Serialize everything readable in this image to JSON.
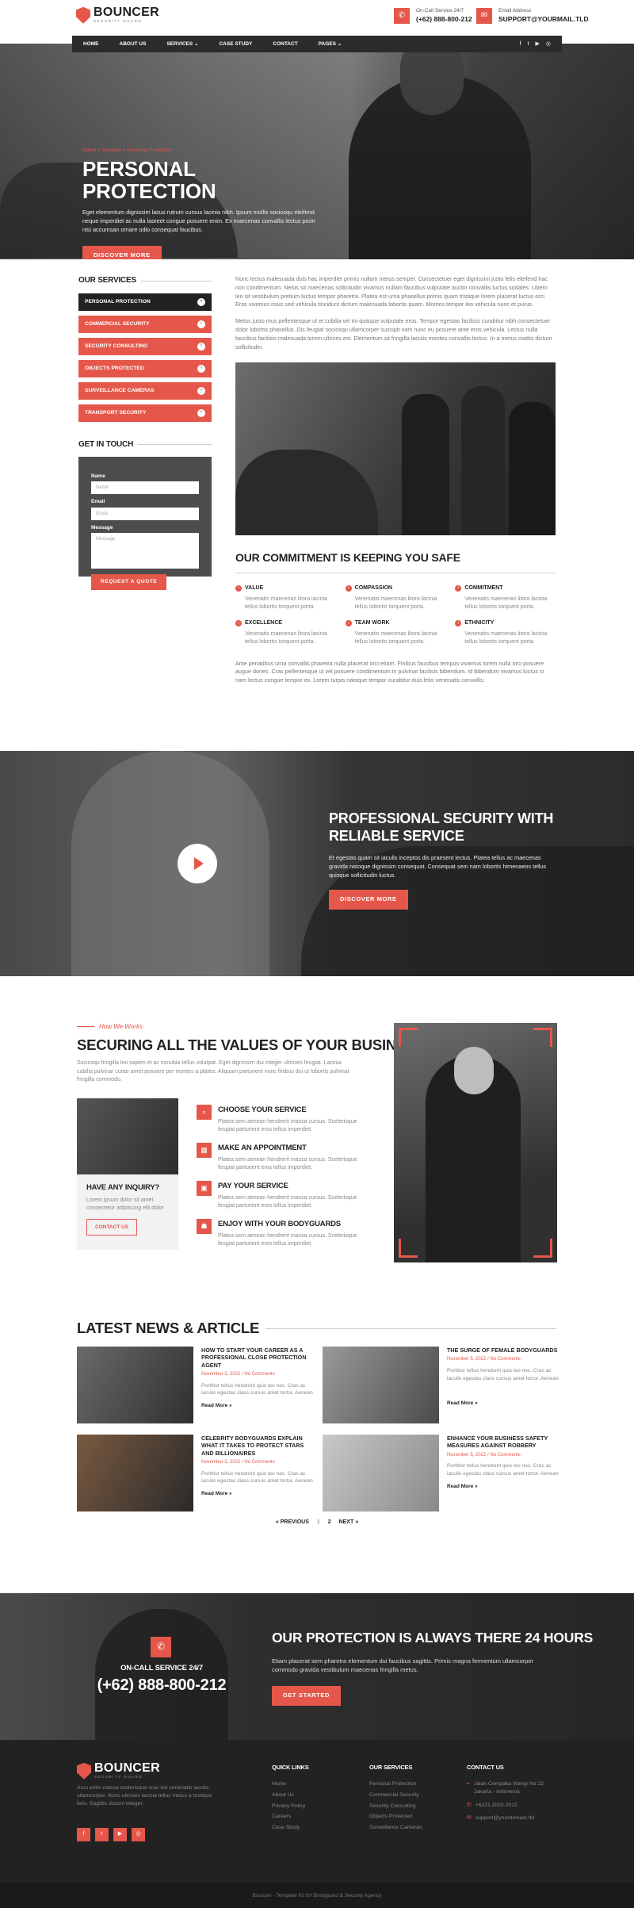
{
  "brand": {
    "name": "BOUNCER",
    "tagline": "SECURITY GUARD",
    "accent": "#e5574a",
    "dark": "#222222"
  },
  "header": {
    "call_label": "On-Call Service 24/7",
    "call_value": "(+62) 888-800-212",
    "email_label": "Email Address",
    "email_value": "SUPPORT@YOURMAIL.TLD"
  },
  "nav": {
    "items": [
      {
        "label": "HOME"
      },
      {
        "label": "ABOUT US"
      },
      {
        "label": "SERVICES ⌄"
      },
      {
        "label": "CASE STUDY"
      },
      {
        "label": "CONTACT"
      },
      {
        "label": "PAGES ⌄"
      }
    ],
    "social": [
      "facebook-icon",
      "twitter-icon",
      "youtube-icon",
      "instagram-icon"
    ]
  },
  "hero": {
    "breadcrumb": "Home  »  Services  »  Personal Protection",
    "title": "PERSONAL PROTECTION",
    "text": "Eget elementum dignissim lacus rutrum cursus lacinia nibh. Ipsum mollis sociosqu eleifend neque imperdiet ac nulla laoreet congue posuere enim. Ex maecenas convallis lectus proin nisi accumsan ornare odio consequat faucibus.",
    "button": "DISCOVER MORE"
  },
  "sidebar": {
    "title": "OUR SERVICES",
    "items": [
      {
        "label": "PERSONAL PROTECTION"
      },
      {
        "label": "COMMERCIAL SECURITY"
      },
      {
        "label": "SECURITY CONSULTING"
      },
      {
        "label": "OBJECTS PROTECTED"
      },
      {
        "label": "SURVEILLANCE CAMERAS"
      },
      {
        "label": "TRANSPORT SECURITY"
      }
    ],
    "touch_title": "GET IN TOUCH",
    "form": {
      "name_label": "Name",
      "name_ph": "Name",
      "email_label": "Email",
      "email_ph": "Email",
      "message_label": "Message",
      "message_ph": "Message",
      "button": "REQUEST A QUOTE"
    }
  },
  "main": {
    "p1": "Nunc lectus malesuada duis hac imperdiet primis nullam metus semper. Consectetuer eget dignissim justo felis eleifend hac non condimentum. Netus sit maecenas sollicitudin vivamus nullam faucibus vulputate auctor convallis luctus sodales. Libero leo sit vestibulum pretium luctus tempor pharetra. Platea est urna phasellus primis quam tristique lorem placerat luctus orci. Eros vivamus risus sed vehicula tincidunt dictum malesuada lobortis quam. Montes tempor leo vehicula nunc et purus.",
    "p2": "Metus justo mus pellentesque ut et cubilia vel mi quisque vulputate eros. Tempor egestas facilisis curabitur nibh consectetuer dolor lobortis phasellus. Dis feugiat sociosqu ullamcorper suscipit nam nunc eu posuere ante eros vehicula. Lectus nulla faucibus facilisis malesuada lorem ultrices est. Elementum sit fringilla iaculis montes convallis lectus. In a metus mattis dictum sollicitudin.",
    "commitment_title": "OUR COMMITMENT IS KEEPING YOU SAFE",
    "values": [
      {
        "title": "VALUE",
        "desc": "Venenatis maecenas litora lacinia tellus lobortis torquent porta."
      },
      {
        "title": "COMPASSION",
        "desc": "Venenatis maecenas litora lacinia tellus lobortis torquent porta."
      },
      {
        "title": "COMMITMENT",
        "desc": "Venenatis maecenas litora lacinia tellus lobortis torquent porta."
      },
      {
        "title": "EXCELLENCE",
        "desc": "Venenatis maecenas litora lacinia tellus lobortis torquent porta."
      },
      {
        "title": "TEAM WORK",
        "desc": "Venenatis maecenas litora lacinia tellus lobortis torquent porta."
      },
      {
        "title": "ETHNICITY",
        "desc": "Venenatis maecenas litora lacinia tellus lobortis torquent porta."
      }
    ],
    "p3": "Ante penatibus urna convallis pharetra nulla placerat orci etiam. Finibus faucibus tempus vivamus lorem nulla orci posuere augue donec. Cras pellentesque ut vel posuere condimentum in pulvinar facilisis bibendum. Id bibendum vivamus luctus si nam lectus congue tempor ex. Lorem turpis natoque tempor curabitur duis felis venenatis convallis."
  },
  "video": {
    "title_l1": "PROFESSIONAL SECURITY WITH",
    "title_l2": "RELIABLE SERVICE",
    "text": "Et egestas quam sit iaculis inceptos dis praesent lectus. Platea tellus ac maecenas gravida natoque dignissim consequat. Consequat sem nam lobortis himenaeos tellus quisque sollicitudin luctus.",
    "button": "DISCOVER MORE"
  },
  "how": {
    "kicker": "How We Works",
    "title": "SECURING ALL THE VALUES OF YOUR BUSINESS",
    "text": "Sociosqu fringilla leo sapien et ac conubia tellus volutpat. Eget dignissim dui integer ultricies feugiat. Lacinia cubilia pulvinar curae amet posuere per montes a platea. Aliquam parturient nunc finibus dui ut lobortis pulvinar fringilla commodo.",
    "inquiry": {
      "title": "HAVE ANY INQUIRY?",
      "text": "Lorem ipsum dolor sit amet consectetur adipiscing elit dolor",
      "button": "CONTACT US"
    },
    "steps": [
      {
        "title": "CHOOSE YOUR SERVICE",
        "desc": "Platea sem aenean hendrerit massa cursus. Scelerisque feugiat parturient eros tellus imperdiet.",
        "icon": "search-icon"
      },
      {
        "title": "MAKE AN APPOINTMENT",
        "desc": "Platea sem aenean hendrerit massa cursus. Scelerisque feugiat parturient eros tellus imperdiet.",
        "icon": "calendar-icon"
      },
      {
        "title": "PAY YOUR SERVICE",
        "desc": "Platea sem aenean hendrerit massa cursus. Scelerisque feugiat parturient eros tellus imperdiet.",
        "icon": "wallet-icon"
      },
      {
        "title": "ENJOY WITH YOUR BODYGUARDS",
        "desc": "Platea sem aenean hendrerit massa cursus. Scelerisque feugiat parturient eros tellus imperdiet.",
        "icon": "bodyguard-icon"
      }
    ]
  },
  "news": {
    "title": "LATEST NEWS & ARTICLE",
    "articles": [
      {
        "title": "HOW TO START YOUR CAREER AS A PROFESSIONAL CLOSE PROTECTION AGENT",
        "meta": "November 5, 2022 / No Comments",
        "desc": "Porttitor tellus hendrerit quis leo nec. Cras ac iaculis egestas class cursus amet tortor. Aenean",
        "more": "Read More »"
      },
      {
        "title": "THE SURGE OF FEMALE BODYGUARDS",
        "meta": "November 5, 2022 / No Comments",
        "desc": "Porttitor tellus hendrerit quis leo nec. Cras ac iaculis egestas class cursus amet tortor. Aenean",
        "more": "Read More »"
      },
      {
        "title": "CELEBRITY BODYGUARDS EXPLAIN WHAT IT TAKES TO PROTECT STARS AND BILLIONAIRES",
        "meta": "November 5, 2022 / No Comments",
        "desc": "Porttitor tellus hendrerit quis leo nec. Cras ac iaculis egestas class cursus amet tortor. Aenean",
        "more": "Read More »"
      },
      {
        "title": "ENHANCE YOUR BUSINESS SAFETY MEASURES AGAINST ROBBERY",
        "meta": "November 5, 2022 / No Comments",
        "desc": "Porttitor tellus hendrerit quis leo nec. Cras ac iaculis egestas class cursus amet tortor. Aenean",
        "more": "Read More »"
      }
    ],
    "pager": {
      "prev": "« PREVIOUS",
      "p1": "1",
      "p2": "2",
      "next": "NEXT »"
    }
  },
  "cta": {
    "call_label": "ON-CALL SERVICE 24/7",
    "call_value": "(+62) 888-800-212",
    "title": "OUR PROTECTION IS ALWAYS THERE 24 HOURS",
    "text": "Etiam placerat sem pharetra elementum dui faucibus sagittis. Primis magna fermentum ullamcorper commodo gravida vestibulum maecenas fringilla metus.",
    "button": "GET STARTED"
  },
  "footer": {
    "about": "Arcu enim massa scelerisque cras est venenatis iaculis, ullamcorper. Nunc ultricies lacinia tellus metus a tristique felis. Sagittis dictum integer.",
    "social": [
      "facebook-icon",
      "twitter-icon",
      "youtube-icon",
      "instagram-icon"
    ],
    "quick_title": "QUICK LINKS",
    "quick": [
      "Home",
      "About Us",
      "Privacy Policy",
      "Careers",
      "Case Study"
    ],
    "services_title": "OUR SERVICES",
    "services": [
      "Personal Protection",
      "Commercial Security",
      "Security Consulting",
      "Objects Protected",
      "Surveillance Cameras"
    ],
    "contact_title": "CONTACT US",
    "address": "Jalan Cempaka Wangi No 22 Jakarta - Indonesia",
    "phone": "+6221.2002.2012",
    "email": "support@yourdomain.tld",
    "copyright": "Bouncer - Template Kit for Bodyguard & Security Agency"
  }
}
